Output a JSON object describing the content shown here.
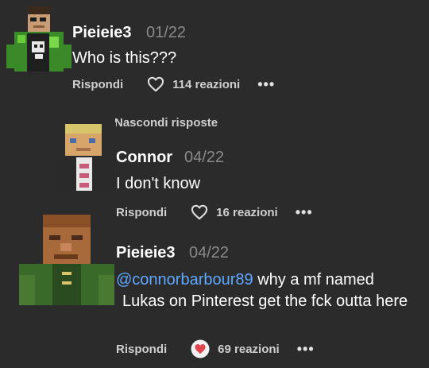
{
  "comments": [
    {
      "username": "Pieieie3",
      "date": "01/22",
      "text": "Who is this???",
      "reply_label": "Rispondi",
      "reaction_count": "114 reazioni",
      "more": "•••"
    },
    {
      "username": "Connor",
      "date": "04/22",
      "text": "I don't know",
      "reply_label": "Rispondi",
      "reaction_count": "16 reazioni",
      "more": "•••"
    },
    {
      "username": "Pieieie3",
      "date": "04/22",
      "mention": "@connorbarbour89",
      "text_part1": " why a mf named",
      "text_part2": "Lukas",
      "text_part3": " on Pinterest get the fck outta here",
      "reply_label": "Rispondi",
      "reaction_count": "69 reazioni",
      "more": "•••"
    }
  ],
  "hide_replies_label": "Nascondi risposte",
  "colors": {
    "background": "#2b2b2b",
    "mention": "#5fa8ff",
    "date": "#8a8a8a",
    "heart_reaction": "#e0454f"
  },
  "icons": [
    "heart-outline-icon",
    "heart-filled-icon",
    "more-dots-icon"
  ]
}
